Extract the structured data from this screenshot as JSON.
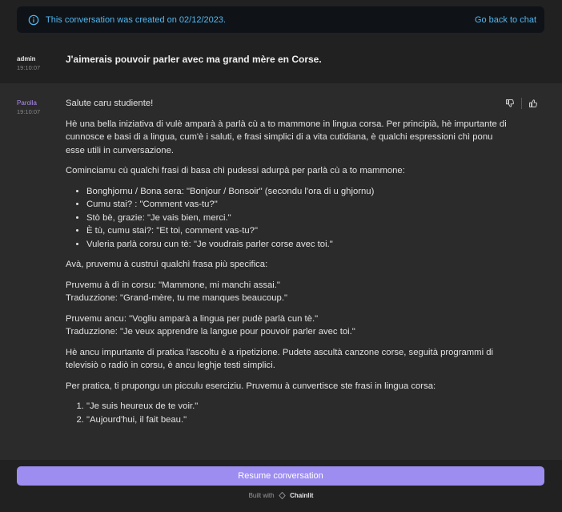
{
  "banner": {
    "message": "This conversation was created on 02/12/2023.",
    "back_link": "Go back to chat",
    "icon": "info-icon",
    "color": "#53b8f0"
  },
  "messages": {
    "user": {
      "author": "admin",
      "time": "19:10:07",
      "text": "J'aimerais pouvoir parler avec ma grand mère en Corse."
    },
    "bot": {
      "author": "Parolla",
      "time": "19:10:07",
      "author_color": "#b18cf0",
      "greeting": "Salute caru studiente!",
      "p1": "Hè una bella iniziativa di vulè amparà à parlà cù a to mammone in lingua corsa. Per principià, hè impurtante di cunnosce e basi di a lingua, cum'è i saluti, e frasi simplici di a vita cutidiana, è qualchi espressioni chì ponu esse utili in cunversazione.",
      "p2": "Cominciamu cù qualchi frasi di basa chì pudessi adurpà per parlà cù a to mammone:",
      "list1": [
        "Bonghjornu / Bona sera: \"Bonjour / Bonsoir\" (secondu l'ora di u ghjornu)",
        "Cumu stai? : \"Comment vas-tu?\"",
        "Stò bè, grazie: \"Je vais bien, merci.\"",
        "È tù, cumu stai?: \"Et toi, comment vas-tu?\"",
        "Vuleria parlà corsu cun tè: \"Je voudrais parler corse avec toi.\""
      ],
      "p3": "Avà, pruvemu à custruì qualchì frasa più specifica:",
      "p4a": "Pruvemu à dì in corsu: \"Mammone, mi manchi assai.\"",
      "p4b": "Traduzzione: \"Grand-mère, tu me manques beaucoup.\"",
      "p5a": "Pruvemu ancu: \"Vogliu amparà a lingua per pudè parlà cun tè.\"",
      "p5b": "Traduzzione: \"Je veux apprendre la langue pour pouvoir parler avec toi.\"",
      "p6": "Hè ancu impurtante di pratica l'ascoltu è a ripetizione. Pudete ascultà canzone corse, seguità programmi di televisiò o radiò in corsu, è ancu leghje testi simplici.",
      "p7": "Per pratica, ti prupongu un picculu eserciziu. Pruvemu à cunvertisce ste frasi in lingua corsa:",
      "list2": [
        "\"Je suis heureux de te voir.\"",
        "\"Aujourd'hui, il fait beau.\""
      ]
    }
  },
  "feedback": {
    "thumbs_down_icon": "thumbs-down-icon",
    "thumbs_up_icon": "thumbs-up-icon"
  },
  "footer": {
    "resume_label": "Resume conversation",
    "resume_color": "#9d8df1",
    "built_with": "Built with",
    "brand": "Chainlit"
  }
}
